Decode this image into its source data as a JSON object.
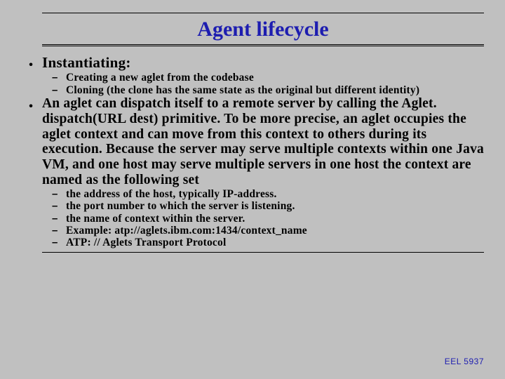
{
  "slide": {
    "title": "Agent lifecycle",
    "bullets": [
      {
        "text": "Instantiating:",
        "sub": [
          "Creating a new aglet from the codebase",
          "Cloning (the clone has the same state as the original but different identity)"
        ]
      },
      {
        "text": "An aglet can dispatch itself to a remote server by calling the Aglet. dispatch(URL dest) primitive. To be more precise, an aglet occupies the aglet context and can move from this context to others during its execution. Because the server may serve multiple contexts within one Java VM, and one host may serve multiple servers in one host the context are named as the following set",
        "sub": [
          "the address of the host, typically IP-address.",
          "the port number to which the server is listening.",
          "the name of context within the server.",
          "Example: atp://aglets.ibm.com:1434/context_name",
          "ATP: // Aglets Transport Protocol"
        ]
      }
    ],
    "footer": "EEL 5937"
  }
}
